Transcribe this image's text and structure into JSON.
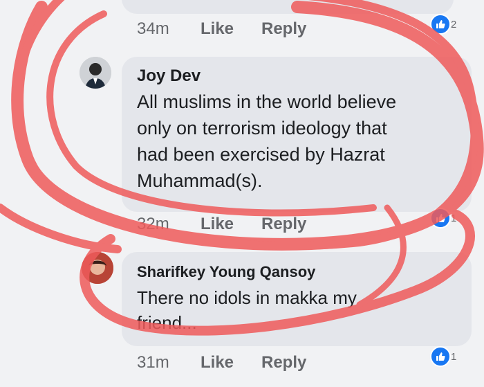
{
  "colors": {
    "annotation": "#ef5b5b",
    "bubble": "#e4e6eb",
    "like_blue": "#1877f2"
  },
  "comments": [
    {
      "author": "",
      "text": "",
      "time": "34m",
      "like": "Like",
      "reply": "Reply",
      "reaction_icon": "thumbs-up-icon",
      "reaction_count": "2"
    },
    {
      "author": "Joy Dev",
      "text_lines": [
        "All muslims in the world believe",
        "only on terrorism ideology that",
        "had been exercised by Hazrat",
        "Muhammad(s)."
      ],
      "time": "32m",
      "like": "Like",
      "reply": "Reply",
      "reaction_icon": "thumbs-up-icon",
      "reaction_count": "1"
    },
    {
      "author": "Sharifkey Young Qansoy",
      "text_lines": [
        "There no idols in makka my",
        "friend..."
      ],
      "time": "31m",
      "like": "Like",
      "reply": "Reply",
      "reaction_icon": "thumbs-up-icon",
      "reaction_count": "1"
    }
  ]
}
